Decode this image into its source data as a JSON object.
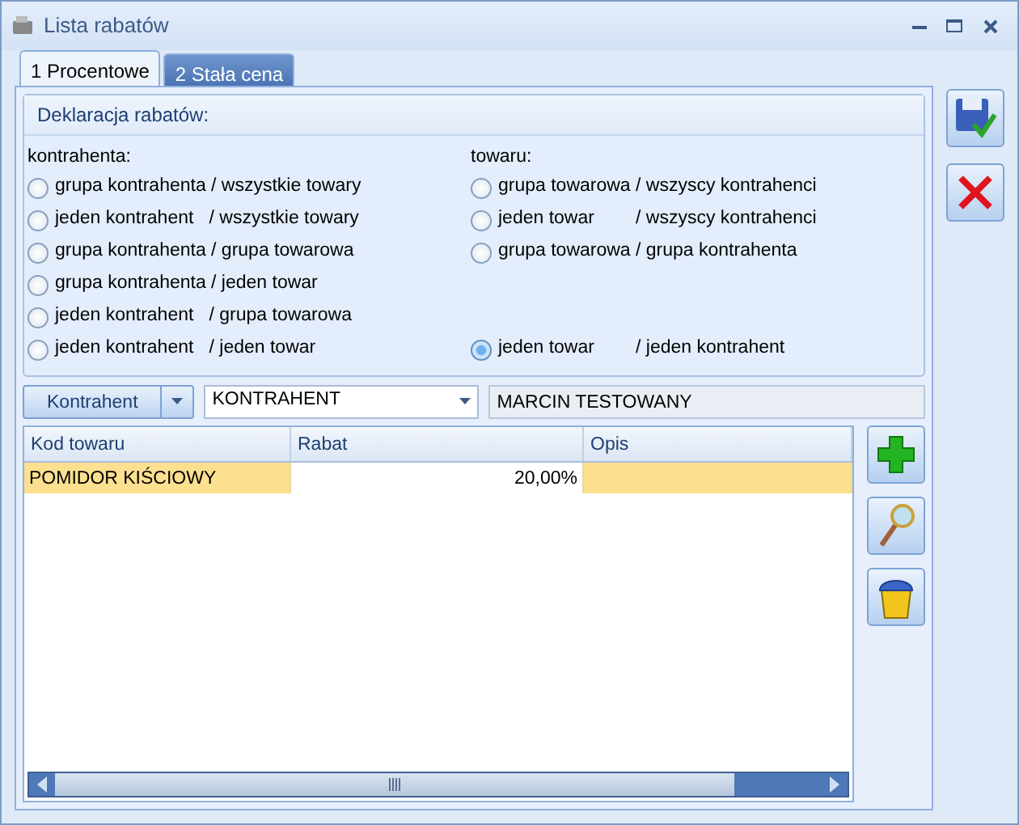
{
  "window": {
    "title": "Lista rabatów"
  },
  "tabs": [
    {
      "label": "1 Procentowe",
      "selected": true
    },
    {
      "label": "2 Stała cena",
      "selected": false
    }
  ],
  "declaration": {
    "title": "Deklaracja rabatów:",
    "columns": [
      {
        "heading": "kontrahenta:",
        "options": [
          {
            "label": "grupa kontrahenta / wszystkie towary",
            "selected": false
          },
          {
            "label": "jeden kontrahent   / wszystkie towary",
            "selected": false
          },
          {
            "label": "grupa kontrahenta / grupa towarowa",
            "selected": false
          },
          {
            "label": "grupa kontrahenta / jeden towar",
            "selected": false
          },
          {
            "label": "jeden kontrahent   / grupa towarowa",
            "selected": false
          },
          {
            "label": "jeden kontrahent   / jeden towar",
            "selected": false
          }
        ]
      },
      {
        "heading": "towaru:",
        "options": [
          {
            "label": "grupa towarowa / wszyscy kontrahenci",
            "selected": false
          },
          {
            "label": "jeden towar        / wszyscy kontrahenci",
            "selected": false
          },
          {
            "label": "grupa towarowa / grupa kontrahenta",
            "selected": false
          },
          {
            "label": "jeden towar        / jeden kontrahent",
            "selected": true
          }
        ]
      }
    ]
  },
  "filter": {
    "button": "Kontrahent",
    "combo": "KONTRAHENT",
    "name": "MARCIN TESTOWANY"
  },
  "table": {
    "columns": [
      "Kod towaru",
      "Rabat",
      "Opis"
    ],
    "rows": [
      {
        "cells": [
          "POMIDOR KIŚCIOWY",
          "20,00%",
          ""
        ],
        "selected": true
      }
    ]
  }
}
